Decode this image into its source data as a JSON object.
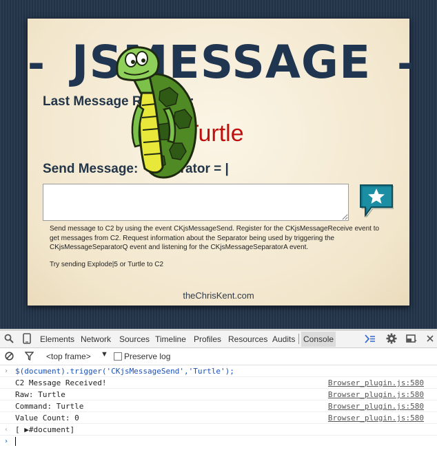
{
  "page": {
    "banner": {
      "dash_left": "-",
      "title": "JSMESSAGE",
      "dash_right": "-"
    },
    "last_message_label": "Last Message Received:",
    "last_message_value": "Turtle",
    "send_label": "Send Message:   Separator = |",
    "input_value": "",
    "send_button_icon": "star-speech-bubble-icon",
    "help_text_1": "Send message to C2 by using the event CKjsMessageSend. Register for the CKjsMessageReceive event to get messages from C2. Request information about the Separator being used by triggering the CKjsMessageSeparatorQ event and listening for the CKjsMessageSeparatorA event.",
    "help_text_2": "Try sending Explode|5 or Turtle to C2",
    "footer": "theChrisKent.com",
    "colors": {
      "background": "#23344a",
      "card": "#f5ecd7",
      "heading": "#233548",
      "value": "#c0100d",
      "button": "#1b8ea3"
    }
  },
  "devtools": {
    "tabs": [
      {
        "label": "Elements"
      },
      {
        "label": "Network"
      },
      {
        "label": "Sources"
      },
      {
        "label": "Timeline"
      },
      {
        "label": "Profiles"
      },
      {
        "label": "Resources"
      },
      {
        "label": "Audits"
      },
      {
        "label": "Console",
        "active": true
      }
    ],
    "frame_select": "<top frame>",
    "preserve_log_label": "Preserve log",
    "preserve_log_checked": false,
    "console": {
      "input_command": "$(document).trigger('CKjsMessageSend','Turtle');",
      "logs": [
        {
          "text": "C2 Message Received!",
          "source": "Browser_plugin.js:580"
        },
        {
          "text": "Raw: Turtle",
          "source": "Browser_plugin.js:580"
        },
        {
          "text": "Command: Turtle",
          "source": "Browser_plugin.js:580"
        },
        {
          "text": "Value Count: 0",
          "source": "Browser_plugin.js:580"
        }
      ],
      "result": "[ ▶#document]",
      "prompt_value": ""
    },
    "colors": {
      "command": "#1a4fb8",
      "prompt": "#2a78d6",
      "link": "#545454"
    }
  }
}
